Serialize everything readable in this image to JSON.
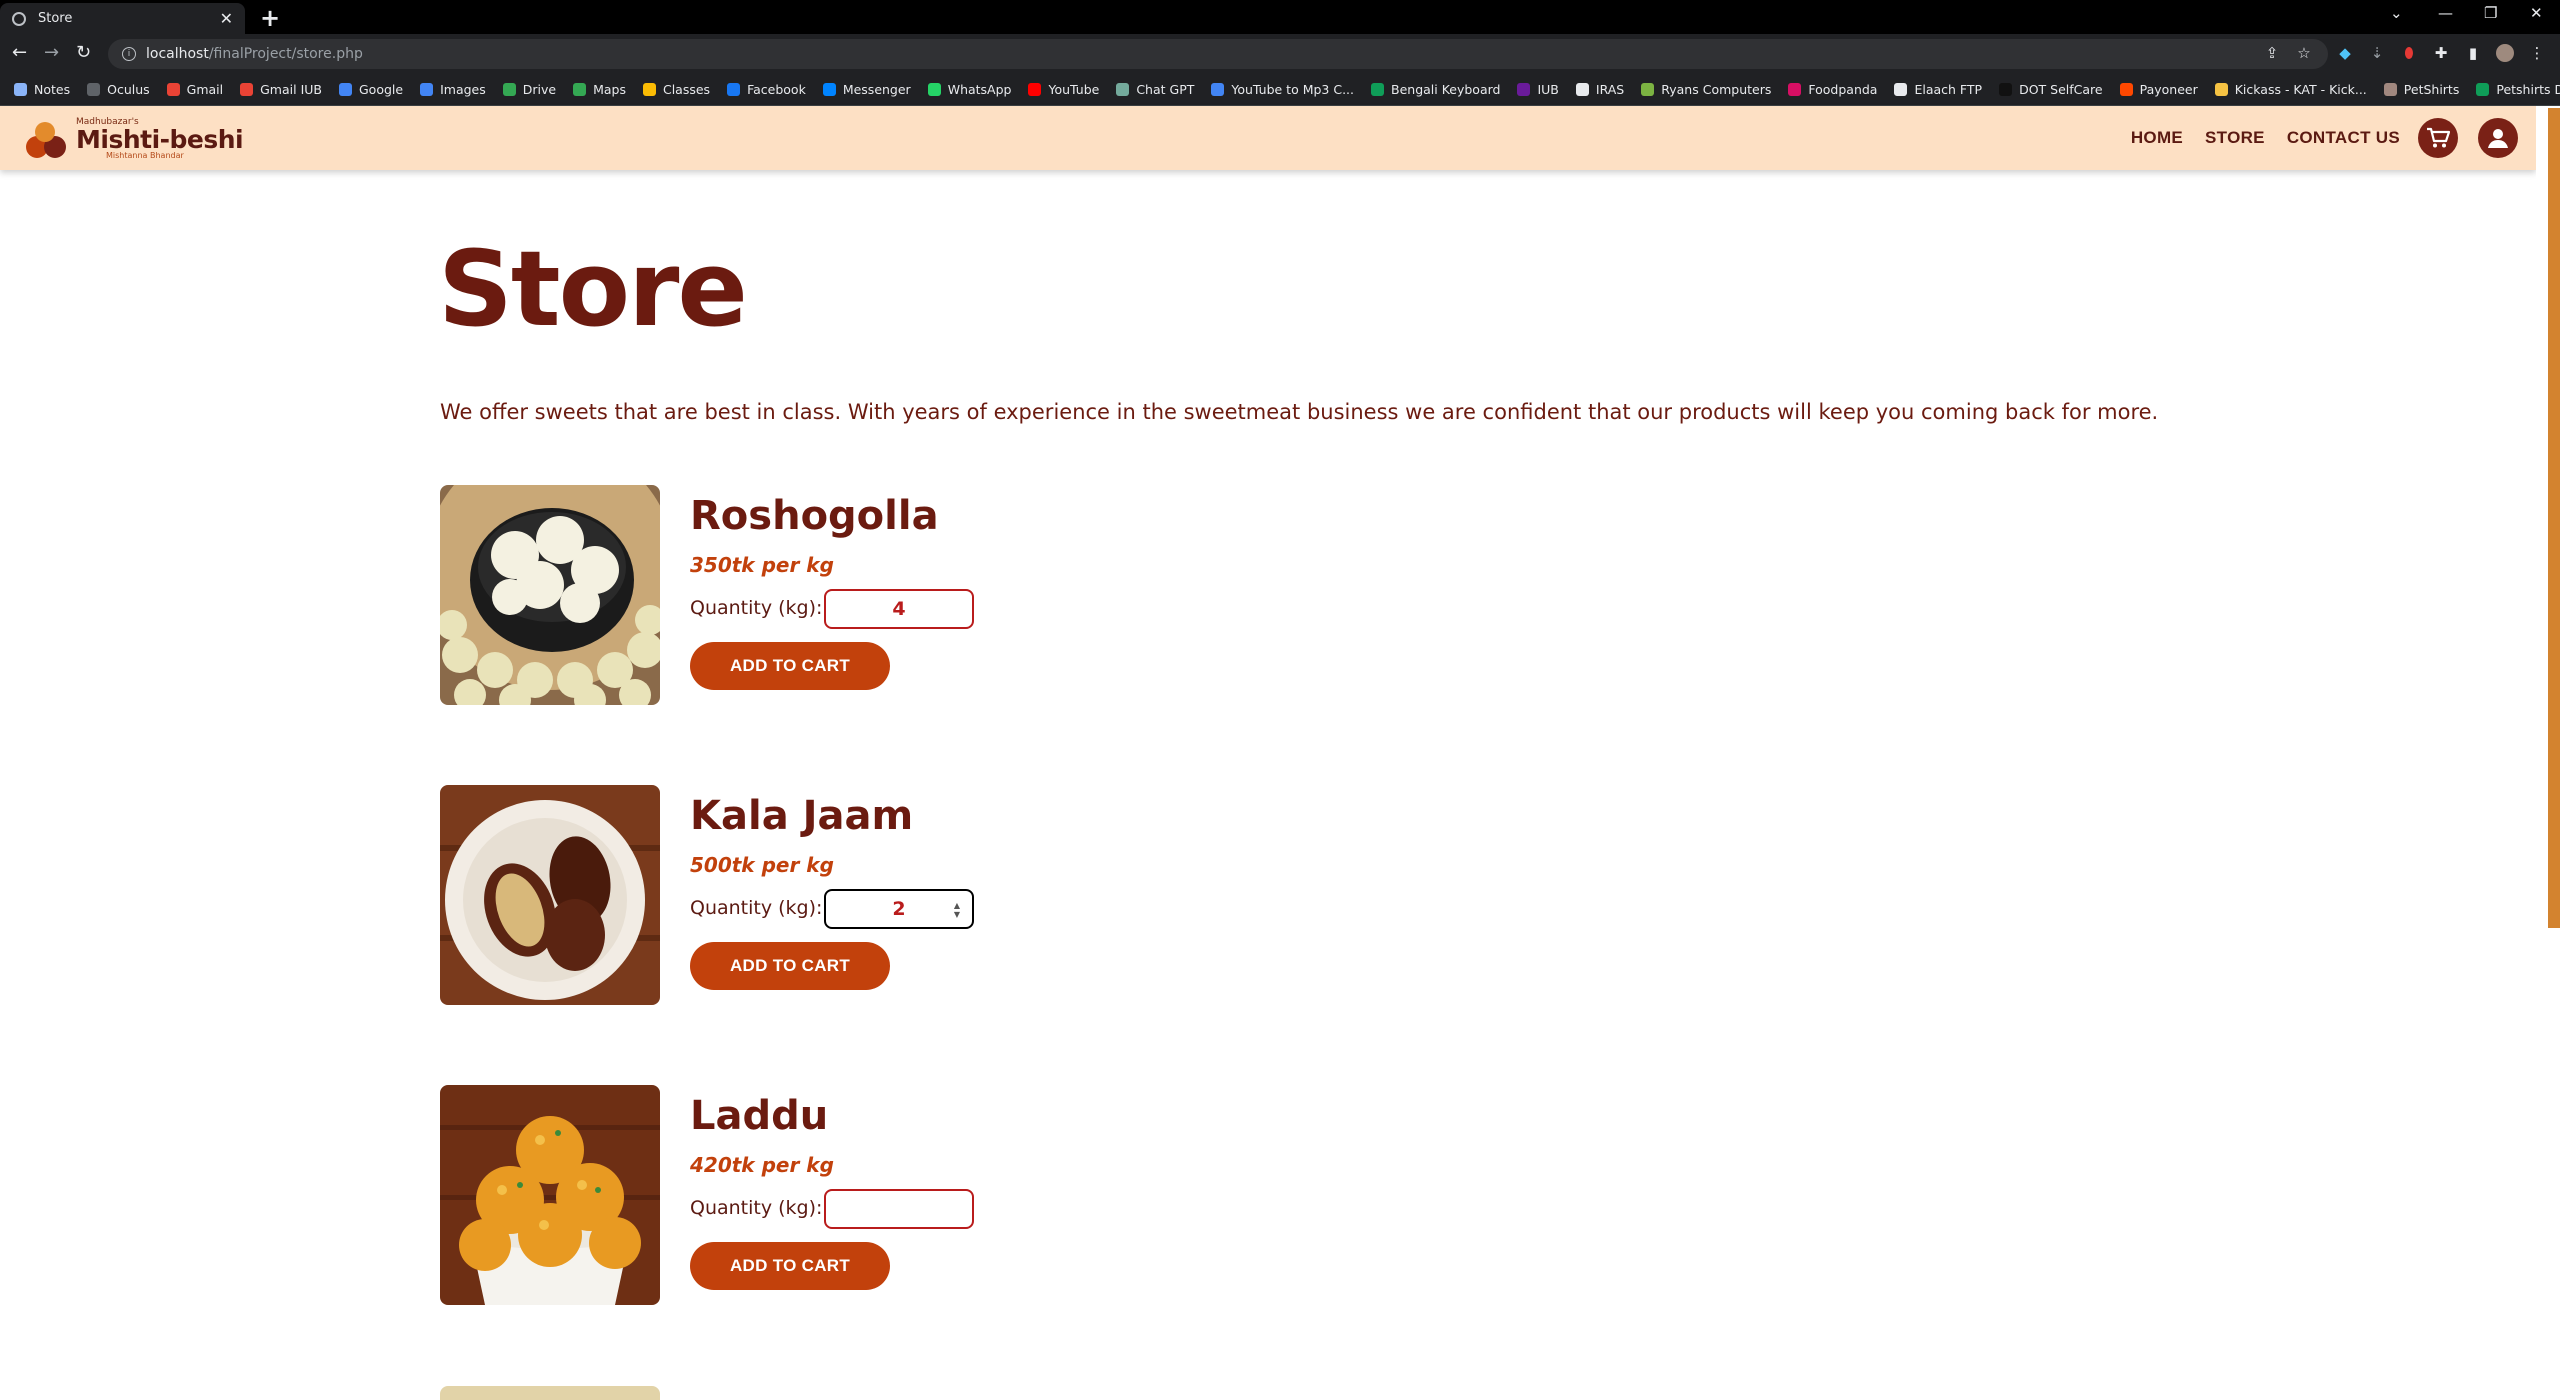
{
  "browser": {
    "tab_title": "Store",
    "url_host": "localhost",
    "url_path": "/finalProject/store.php",
    "bookmarks": [
      {
        "label": "Notes",
        "color": "#8ab4f8"
      },
      {
        "label": "Oculus",
        "color": "#5f6368"
      },
      {
        "label": "Gmail",
        "color": "#ea4335"
      },
      {
        "label": "Gmail IUB",
        "color": "#ea4335"
      },
      {
        "label": "Google",
        "color": "#4285f4"
      },
      {
        "label": "Images",
        "color": "#4285f4"
      },
      {
        "label": "Drive",
        "color": "#34a853"
      },
      {
        "label": "Maps",
        "color": "#34a853"
      },
      {
        "label": "Classes",
        "color": "#fbbc04"
      },
      {
        "label": "Facebook",
        "color": "#1877f2"
      },
      {
        "label": "Messenger",
        "color": "#0084ff"
      },
      {
        "label": "WhatsApp",
        "color": "#25d366"
      },
      {
        "label": "YouTube",
        "color": "#ff0000"
      },
      {
        "label": "Chat GPT",
        "color": "#74aa9c"
      },
      {
        "label": "YouTube to Mp3 C...",
        "color": "#4285f4"
      },
      {
        "label": "Bengali Keyboard",
        "color": "#0f9d58"
      },
      {
        "label": "IUB",
        "color": "#6a1b9a"
      },
      {
        "label": "IRAS",
        "color": "#e8eaed"
      },
      {
        "label": "Ryans Computers",
        "color": "#7cb342"
      },
      {
        "label": "Foodpanda",
        "color": "#d70f64"
      },
      {
        "label": "Elaach FTP",
        "color": "#e8eaed"
      },
      {
        "label": "DOT SelfCare",
        "color": "#111111"
      },
      {
        "label": "Payoneer",
        "color": "#ff4800"
      },
      {
        "label": "Kickass - KAT - Kick...",
        "color": "#f6c343"
      },
      {
        "label": "PetShirts",
        "color": "#a1887f"
      },
      {
        "label": "Petshirts Designs",
        "color": "#0f9d58"
      }
    ]
  },
  "site": {
    "logo_small": "Madhubazar's",
    "logo_main": "Mishti-beshi",
    "logo_sub": "Mishtanna Bhandar",
    "nav": {
      "home": "HOME",
      "store": "STORE",
      "contact": "CONTACT US"
    }
  },
  "page": {
    "title": "Store",
    "intro": "We offer sweets that are best in class. With years of experience in the sweetmeat business we are confident that our products will keep you coming back for more.",
    "quantity_label": "Quantity (kg):",
    "add_to_cart": "ADD TO CART",
    "products": [
      {
        "name": "Roshogolla",
        "price": "350tk per kg",
        "quantity": "4"
      },
      {
        "name": "Kala Jaam",
        "price": "500tk per kg",
        "quantity": "2"
      },
      {
        "name": "Laddu",
        "price": "420tk per kg",
        "quantity": ""
      }
    ]
  },
  "colors": {
    "brand_dark": "#6b1b10",
    "brand_accent": "#c2410c",
    "header_bg": "#fde0c4"
  }
}
